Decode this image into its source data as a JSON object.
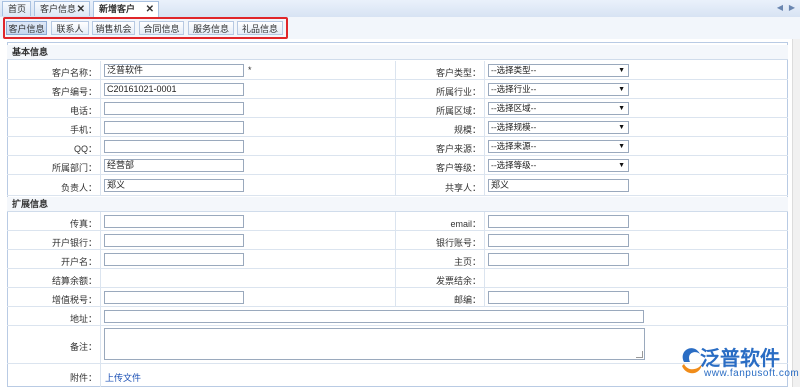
{
  "page_tabs": [
    {
      "label": "首页",
      "closable": false
    },
    {
      "label": "客户信息",
      "closable": true
    },
    {
      "label": "新增客户",
      "closable": true
    }
  ],
  "sub_tabs": [
    "客户信息",
    "联系人",
    "销售机会",
    "合同信息",
    "服务信息",
    "礼品信息"
  ],
  "basic_section": "基本信息",
  "extended_section": "扩展信息",
  "fields": {
    "customer_name": {
      "label": "客户名称：",
      "value": "泛普软件",
      "required_mark": "*"
    },
    "customer_type": {
      "label": "客户类型：",
      "value": "--选择类型--"
    },
    "customer_no": {
      "label": "客户编号：",
      "value": "C20161021-0001"
    },
    "industry": {
      "label": "所属行业：",
      "value": "--选择行业--"
    },
    "phone": {
      "label": "电话：",
      "value": ""
    },
    "region": {
      "label": "所属区域：",
      "value": "--选择区域--"
    },
    "mobile": {
      "label": "手机：",
      "value": ""
    },
    "scale": {
      "label": "规模：",
      "value": "--选择规模--"
    },
    "qq": {
      "label": "QQ：",
      "value": ""
    },
    "source": {
      "label": "客户来源：",
      "value": "--选择来源--"
    },
    "department": {
      "label": "所属部门：",
      "value": "经营部"
    },
    "level": {
      "label": "客户等级：",
      "value": "--选择等级--"
    },
    "owner": {
      "label": "负责人：",
      "value": "郑义"
    },
    "sharer": {
      "label": "共享人：",
      "value": "郑义"
    },
    "fax": {
      "label": "传真：",
      "value": ""
    },
    "email": {
      "label": "email：",
      "value": ""
    },
    "bank": {
      "label": "开户银行：",
      "value": ""
    },
    "bank_account": {
      "label": "银行账号：",
      "value": ""
    },
    "account_name": {
      "label": "开户名：",
      "value": ""
    },
    "homepage": {
      "label": "主页：",
      "value": ""
    },
    "balance": {
      "label": "结算余额：",
      "value": ""
    },
    "invoice_balance": {
      "label": "发票结余：",
      "value": ""
    },
    "vat_no": {
      "label": "增值税号：",
      "value": ""
    },
    "postcode": {
      "label": "邮编：",
      "value": ""
    },
    "address": {
      "label": "地址：",
      "value": ""
    },
    "remark": {
      "label": "备注：",
      "value": ""
    },
    "attachment": {
      "label": "附件：",
      "link": "上传文件"
    }
  },
  "watermark": {
    "brand": "泛普软件",
    "url": "www.fanpusoft.com"
  },
  "colors": {
    "highlight_border": "#e0262a",
    "link": "#1a4fb5",
    "brand": "#2a6dc4"
  }
}
